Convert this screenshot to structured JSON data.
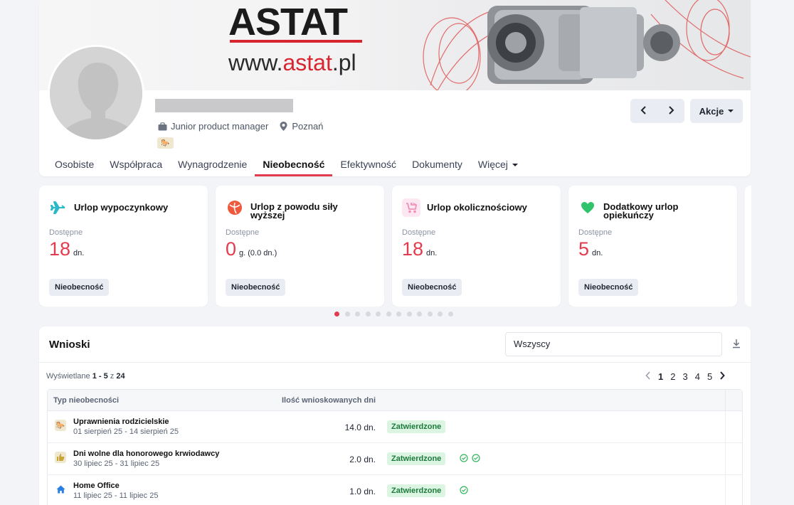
{
  "banner": {
    "logo": "ASTAT",
    "url_prefix": "www.",
    "url_brand": "astat",
    "url_suffix": ".pl"
  },
  "profile": {
    "position": "Junior product manager",
    "location": "Poznań",
    "nav_prev_icon": "chevron-left",
    "nav_next_icon": "chevron-right",
    "actions_label": "Akcje"
  },
  "tabs": [
    {
      "label": "Osobiste",
      "active": false
    },
    {
      "label": "Współpraca",
      "active": false
    },
    {
      "label": "Wynagrodzenie",
      "active": false
    },
    {
      "label": "Nieobecność",
      "active": true
    },
    {
      "label": "Efektywność",
      "active": false
    },
    {
      "label": "Dokumenty",
      "active": false
    },
    {
      "label": "Więcej",
      "active": false
    }
  ],
  "absence_cards": [
    {
      "title": "Urlop wypoczynkowy",
      "available_label": "Dostępne",
      "value": "18",
      "unit": "dn.",
      "tag": "Nieobecność",
      "icon": "plane-icon",
      "color": "#2bb8c8"
    },
    {
      "title": "Urlop z powodu siły wyższej",
      "available_label": "Dostępne",
      "value": "0",
      "unit": "g. (0.0 dn.)",
      "tag": "Nieobecność",
      "icon": "ball-icon",
      "color": "#f05a3c"
    },
    {
      "title": "Urlop okolicznościowy",
      "available_label": "Dostępne",
      "value": "18",
      "unit": "dn.",
      "tag": "Nieobecność",
      "icon": "stroller-icon",
      "color": "#f08fb8"
    },
    {
      "title": "Dodatkowy urlop opiekuńczy",
      "available_label": "Dostępne",
      "value": "5",
      "unit": "dn.",
      "tag": "Nieobecność",
      "icon": "heart-icon",
      "color": "#2fc36b"
    }
  ],
  "carousel": {
    "total": 12,
    "active": 0
  },
  "requests": {
    "title": "Wnioski",
    "filter_value": "Wszyscy",
    "shown_prefix": "Wyświetlane",
    "shown_range": "1 - 5",
    "shown_of": "z",
    "shown_total": "24",
    "pages": [
      "1",
      "2",
      "3",
      "4",
      "5"
    ],
    "active_page": "1",
    "columns": [
      "Typ nieobecności",
      "Ilość wnioskowanych dni"
    ],
    "rows": [
      {
        "name": "Uprawnienia rodzicielskie",
        "dates": "01 sierpień 25 - 14 sierpień 25",
        "days": "14.0 dn.",
        "status": "Zatwierdzone",
        "checks": 0,
        "icon": "stroller-icon"
      },
      {
        "name": "Dni wolne dla honorowego krwiodawcy",
        "dates": "30 lipiec 25 - 31 lipiec 25",
        "days": "2.0 dn.",
        "status": "Zatwierdzone",
        "checks": 2,
        "icon": "thumbs-up-icon"
      },
      {
        "name": "Home Office",
        "dates": "11 lipiec 25 - 11 lipiec 25",
        "days": "1.0 dn.",
        "status": "Zatwierdzone",
        "checks": 1,
        "icon": "home-icon"
      }
    ]
  }
}
